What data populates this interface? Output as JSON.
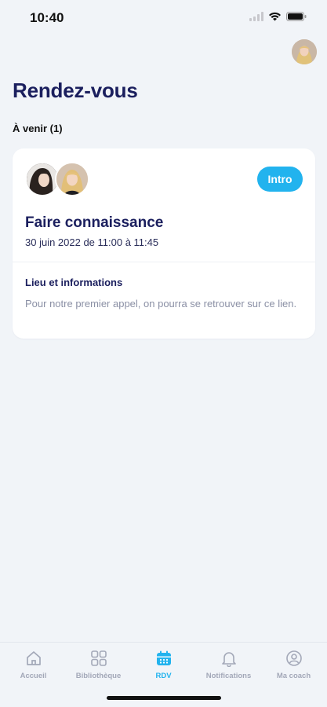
{
  "status_bar": {
    "time": "10:40"
  },
  "header": {
    "title": "Rendez-vous"
  },
  "section": {
    "label": "À venir (1)"
  },
  "appointment": {
    "badge": "Intro",
    "title": "Faire connaissance",
    "date": "30 juin 2022 de 11:00 à 11:45",
    "info_label": "Lieu et informations",
    "info_text": "Pour notre premier appel, on pourra se retrouver sur ce lien."
  },
  "tabs": [
    {
      "label": "Accueil",
      "icon": "home-icon"
    },
    {
      "label": "Bibliothèque",
      "icon": "grid-icon"
    },
    {
      "label": "RDV",
      "icon": "calendar-icon"
    },
    {
      "label": "Notifications",
      "icon": "bell-icon"
    },
    {
      "label": "Ma coach",
      "icon": "user-circle-icon"
    }
  ],
  "colors": {
    "accent": "#22b3ee",
    "title": "#1b1f5e",
    "muted": "#8b90a5",
    "background": "#f1f4f8"
  }
}
